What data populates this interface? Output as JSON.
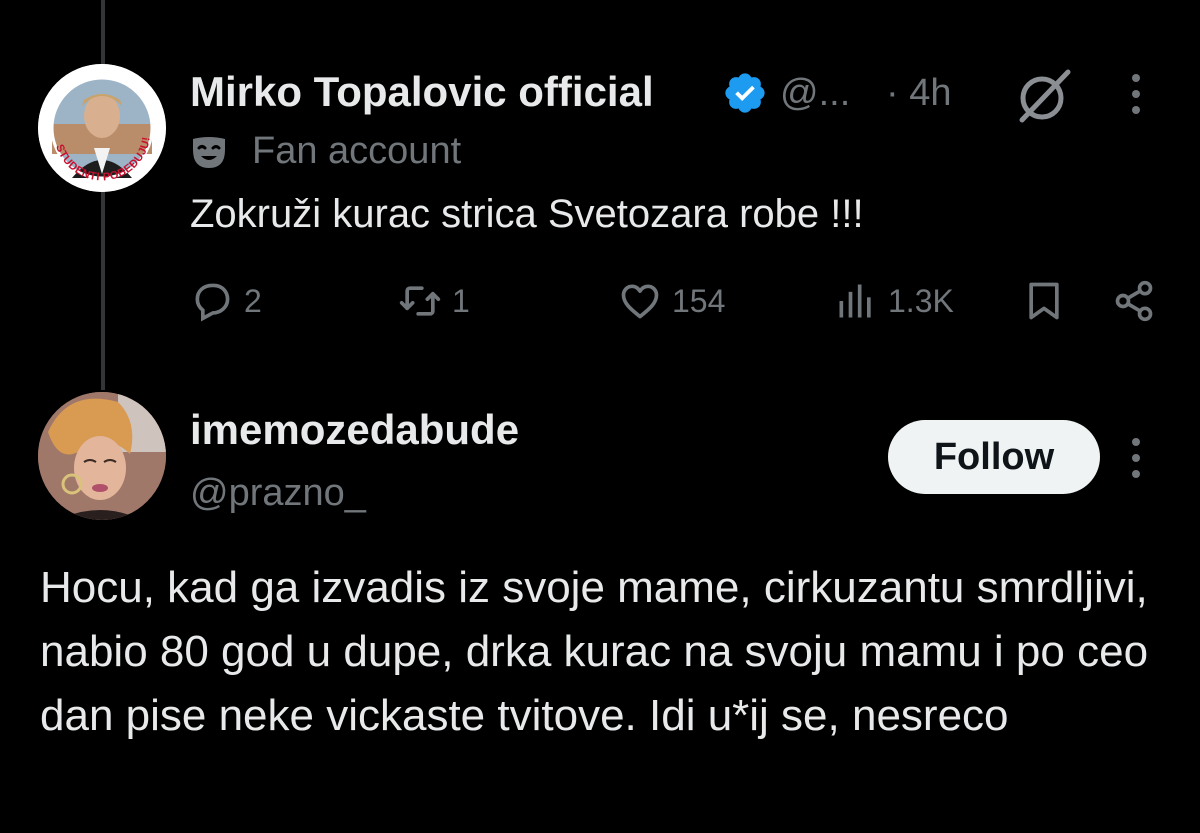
{
  "tweet1": {
    "display_name": "Mirko Topalovic official",
    "handle": "@...",
    "time": "· 4h",
    "avatar_badge_text": "STUDENTI POBEĐUJU!",
    "label": "Fan account",
    "text": "Zokruži kurac strica Svetozara robe !!!",
    "replies": "2",
    "retweets": "1",
    "likes": "154",
    "views": "1.3K"
  },
  "tweet2": {
    "display_name": "imemozedabude",
    "handle": "@prazno_",
    "follow_label": "Follow",
    "text": "Hocu, kad ga izvadis iz svoje mame, cirkuzantu smrdljivi, nabio 80 god u dupe, drka kurac na svoju mamu i po ceo dan pise neke vickaste tvitove. Idi u*ij se, nesreco"
  },
  "colors": {
    "background": "#000000",
    "text_primary": "#e7e9ea",
    "text_secondary": "#71767b",
    "verified": "#1d9bf0",
    "follow_bg": "#eff3f4"
  },
  "icons": [
    "verified-badge-icon",
    "grok-icon",
    "more-icon",
    "fan-account-mask-icon",
    "reply-icon",
    "retweet-icon",
    "like-icon",
    "views-icon",
    "bookmark-icon",
    "share-icon"
  ]
}
